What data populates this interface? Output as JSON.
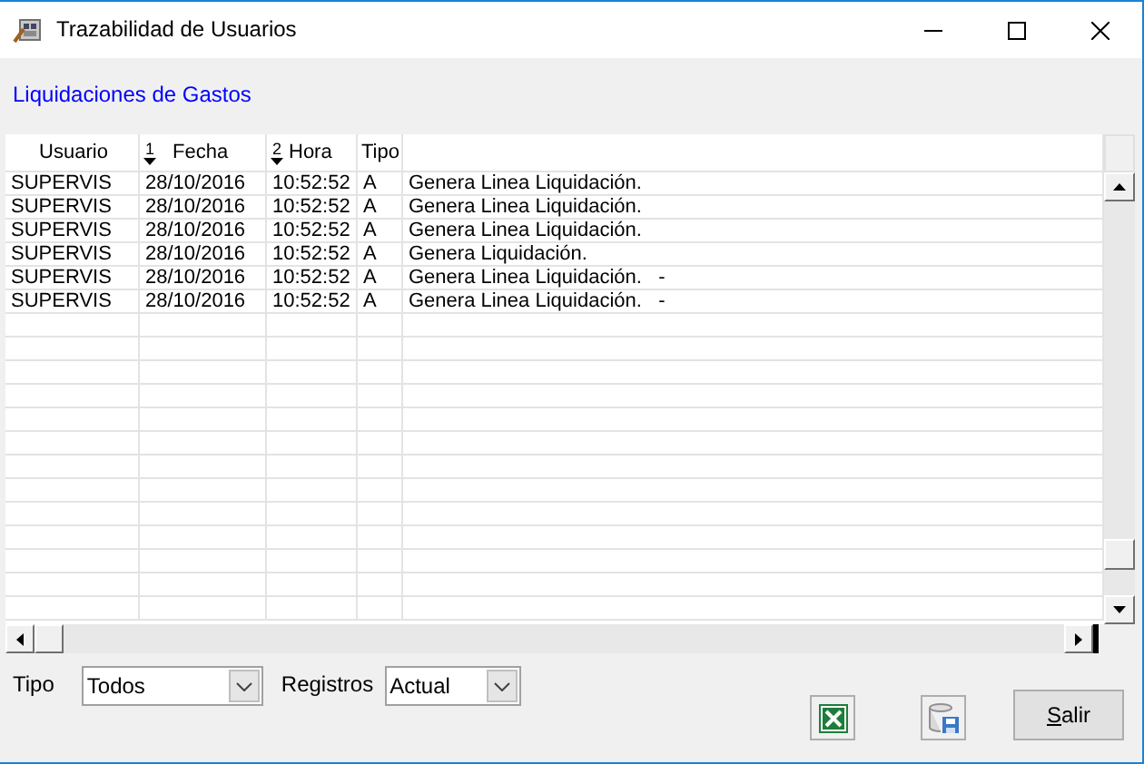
{
  "window": {
    "title": "Trazabilidad de Usuarios"
  },
  "section_link": "Liquidaciones de Gastos",
  "table": {
    "columns": [
      {
        "label": "Usuario"
      },
      {
        "label": "Fecha",
        "sort_order": "1"
      },
      {
        "label": "Hora",
        "sort_order": "2"
      },
      {
        "label": "Tipo"
      }
    ],
    "rows": [
      [
        "SUPERVIS",
        "28/10/2016",
        "10:52:52",
        "A",
        "Genera Linea Liquidación."
      ],
      [
        "SUPERVIS",
        "28/10/2016",
        "10:52:52",
        "A",
        "Genera Linea Liquidación."
      ],
      [
        "SUPERVIS",
        "28/10/2016",
        "10:52:52",
        "A",
        "Genera Linea Liquidación."
      ],
      [
        "SUPERVIS",
        "28/10/2016",
        "10:52:52",
        "A",
        "Genera Liquidación."
      ],
      [
        "SUPERVIS",
        "28/10/2016",
        "10:52:52",
        "A",
        "Genera Linea Liquidación.   -"
      ],
      [
        "SUPERVIS",
        "28/10/2016",
        "10:52:52",
        "A",
        "Genera Linea Liquidación.   -"
      ]
    ]
  },
  "filters": [
    {
      "label": "Tipo",
      "value": "Todos"
    },
    {
      "label": "Registros",
      "value": "Actual"
    }
  ],
  "buttons": [
    {
      "kind": "excel"
    },
    {
      "kind": "save"
    },
    {
      "kind": "text",
      "label": "Salir",
      "mnemonic_underlined": true
    }
  ]
}
